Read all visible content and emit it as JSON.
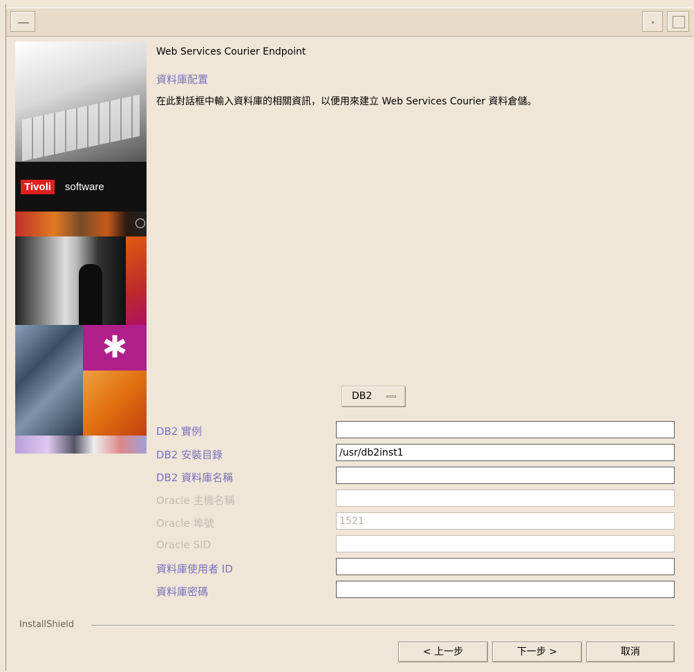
{
  "window": {
    "product_name": "Web Services Courier Endpoint",
    "step_title": "資料庫配置",
    "step_description": "在此對話框中輸入資料庫的相關資訊，以便用來建立 Web Services Courier 資料倉儲。"
  },
  "banner": {
    "brand_red": "Tivoli",
    "brand_suffix": "software"
  },
  "database_type": {
    "selected": "DB2"
  },
  "fields": {
    "db2_instance": {
      "label": "DB2 實例",
      "value": ""
    },
    "db2_install_dir": {
      "label": "DB2 安裝目錄",
      "value": "/usr/db2inst1"
    },
    "db2_db_name": {
      "label": "DB2 資料庫名稱",
      "value": ""
    },
    "oracle_host": {
      "label": "Oracle 主機名稱",
      "value": ""
    },
    "oracle_port": {
      "label": "Oracle 埠號",
      "value": "1521"
    },
    "oracle_sid": {
      "label": "Oracle SID",
      "value": ""
    },
    "db_user_id": {
      "label": "資料庫使用者 ID",
      "value": ""
    },
    "db_password": {
      "label": "資料庫密碼",
      "value": ""
    }
  },
  "footer": {
    "installer_name": "InstallShield",
    "back_label": "< 上一步",
    "next_label": "下一步 >",
    "cancel_label": "取消"
  },
  "colors": {
    "background": "#efe6d8",
    "label_enabled": "#7a70c0",
    "label_disabled": "#c4bcb0",
    "tivoli_red": "#e02020"
  },
  "icons": [
    "window-menu-icon",
    "minimize-icon",
    "maximize-icon",
    "dropdown-indicator-icon",
    "globe-icon",
    "asterisk-icon"
  ]
}
